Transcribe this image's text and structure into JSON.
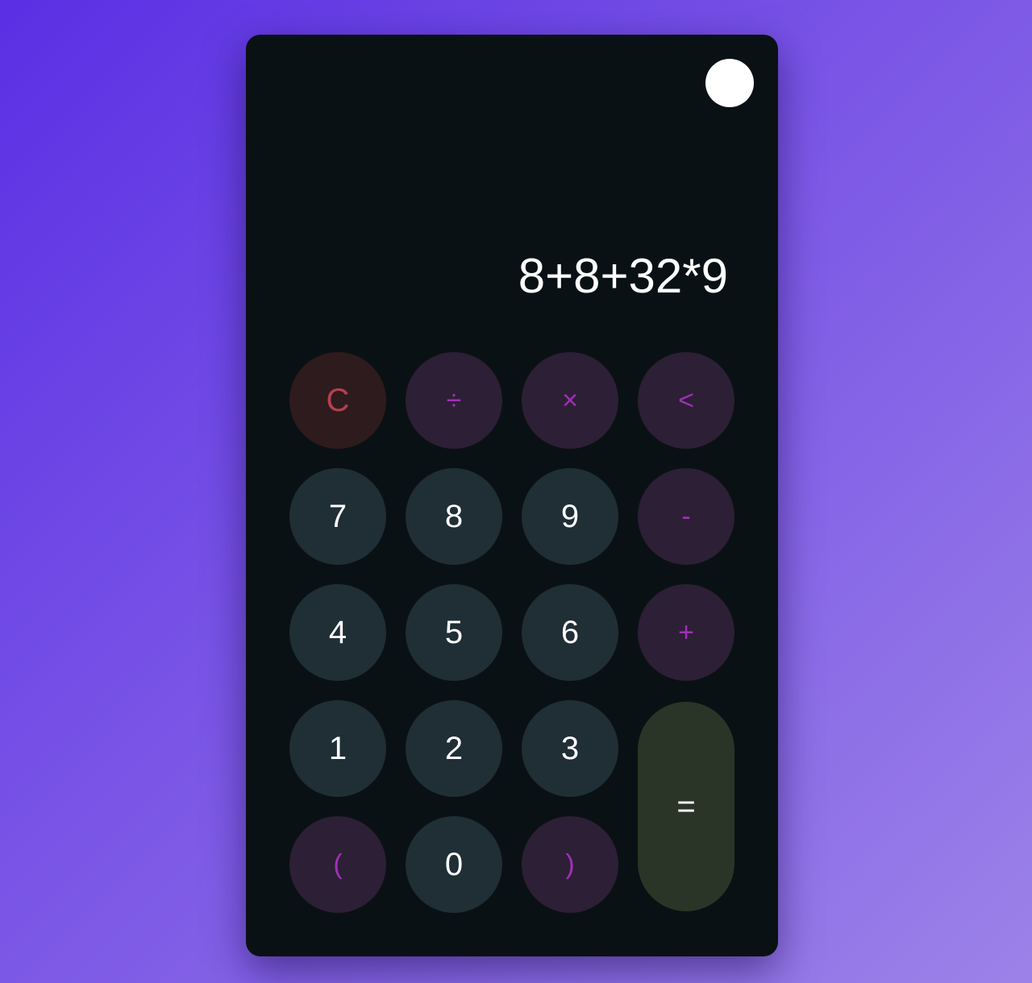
{
  "display": {
    "expression": "8+8+32*9"
  },
  "keys": {
    "clear": "C",
    "divide": "÷",
    "multiply": "×",
    "backspace": "<",
    "seven": "7",
    "eight": "8",
    "nine": "9",
    "minus": "-",
    "four": "4",
    "five": "5",
    "six": "6",
    "plus": "+",
    "one": "1",
    "two": "2",
    "three": "3",
    "equals": "=",
    "open_paren": "(",
    "zero": "0",
    "close_paren": ")"
  },
  "colors": {
    "background_gradient": [
      "#5a2fe4",
      "#9c82e8"
    ],
    "panel": "#0a1114",
    "number_key": "#202e36",
    "operator_key": "#2d1f35",
    "operator_text": "#a030b8",
    "clear_key": "#2e1b1d",
    "clear_text": "#b6404e",
    "equals_key": "#2a3527"
  }
}
